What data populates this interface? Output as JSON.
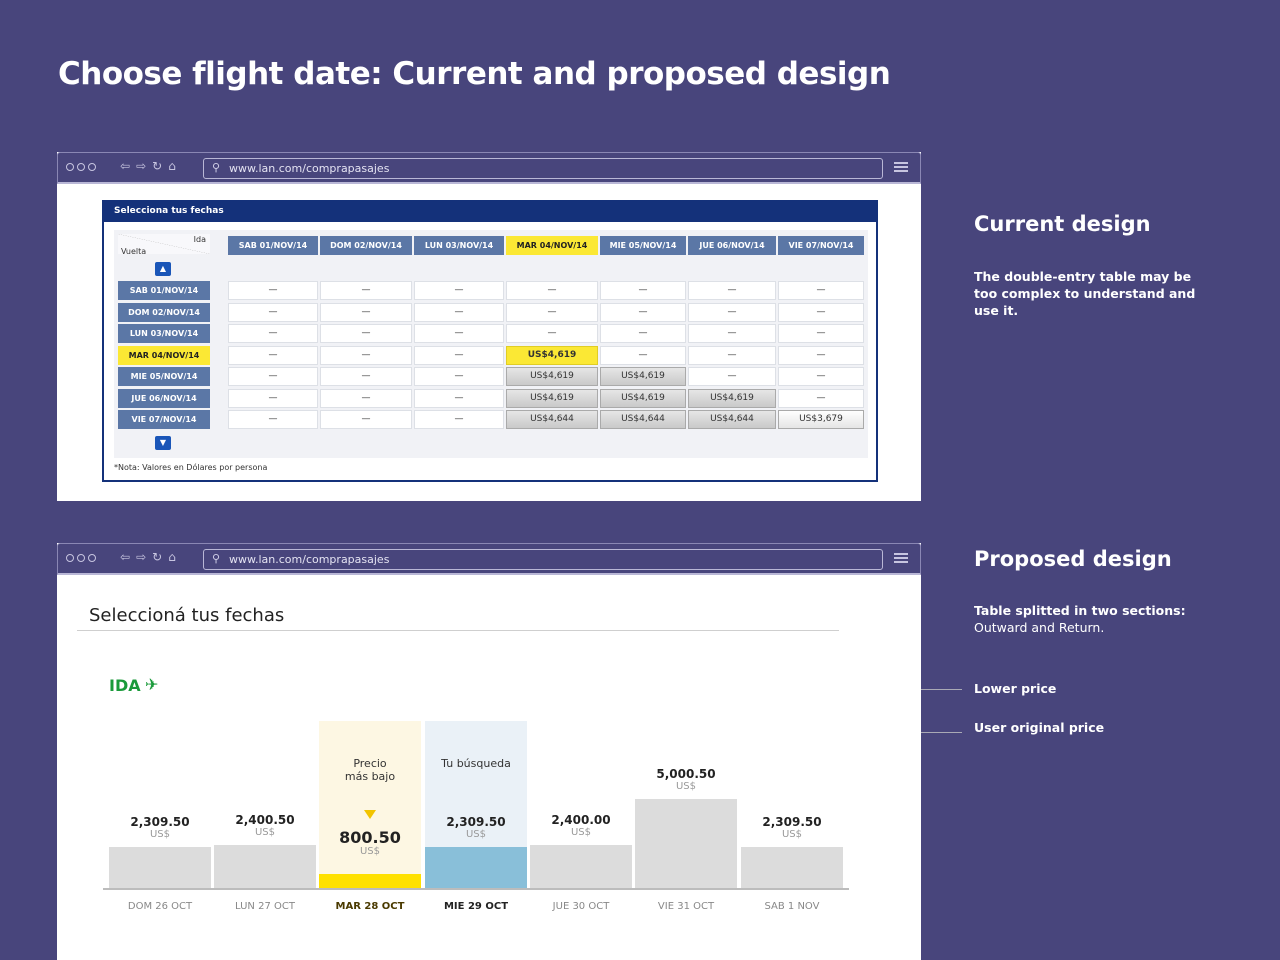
{
  "page": {
    "title": "Choose flight date: Current and proposed design"
  },
  "browser": {
    "url": "www.lan.com/comprapasajes"
  },
  "current": {
    "panel_title": "Selecciona tus fechas",
    "corner_ida": "Ida",
    "corner_vuelta": "Vuelta",
    "columns": [
      "SAB 01/NOV/14",
      "DOM 02/NOV/14",
      "LUN 03/NOV/14",
      "MAR 04/NOV/14",
      "MIE 05/NOV/14",
      "JUE 06/NOV/14",
      "VIE 07/NOV/14"
    ],
    "rows": [
      "SAB 01/NOV/14",
      "DOM 02/NOV/14",
      "LUN 03/NOV/14",
      "MAR 04/NOV/14",
      "MIE 05/NOV/14",
      "JUE 06/NOV/14",
      "VIE 07/NOV/14"
    ],
    "selected_index": 3,
    "cells": [
      [
        "—",
        "—",
        "—",
        "—",
        "—",
        "—",
        "—"
      ],
      [
        "—",
        "—",
        "—",
        "—",
        "—",
        "—",
        "—"
      ],
      [
        "—",
        "—",
        "—",
        "—",
        "—",
        "—",
        "—"
      ],
      [
        "—",
        "—",
        "—",
        "US$4,619",
        "—",
        "—",
        "—"
      ],
      [
        "—",
        "—",
        "—",
        "US$4,619",
        "US$4,619",
        "—",
        "—"
      ],
      [
        "—",
        "—",
        "—",
        "US$4,619",
        "US$4,619",
        "US$4,619",
        "—"
      ],
      [
        "—",
        "—",
        "—",
        "US$4,644",
        "US$4,644",
        "US$4,644",
        "US$3,679"
      ]
    ],
    "note": "*Nota: Valores en Dólares por persona"
  },
  "side": {
    "current_title": "Current design",
    "current_desc": "The double-entry table may be too complex to understand and use it.",
    "proposed_title": "Proposed design",
    "proposed_desc_bold": "Table splitted in two sections:",
    "proposed_desc_normal": "Outward and Return.",
    "lower_price_label": "Lower price",
    "user_price_label": "User original price"
  },
  "proposed": {
    "title": "Seleccioná tus fechas",
    "section_label": "IDA",
    "currency": "US$",
    "lowest_caption": "Precio\nmás bajo",
    "search_caption": "Tu búsqueda",
    "colors": {
      "bar": "#dcdcdc",
      "lowest": "#ffe100",
      "search": "#89bfd9",
      "lowest_bg": "#fdf7e3",
      "search_bg": "#eaf1f7"
    },
    "chart_data": {
      "type": "bar",
      "categories": [
        "DOM 26 OCT",
        "LUN 27 OCT",
        "MAR 28 OCT",
        "MIE 29 OCT",
        "JUE 30 OCT",
        "VIE 31 OCT",
        "SAB 1 NOV"
      ],
      "values": [
        2309.5,
        2400.5,
        800.5,
        2309.5,
        2400.0,
        5000.5,
        2309.5
      ],
      "labels": [
        "2,309.50",
        "2,400.50",
        "800.50",
        "2,309.50",
        "2,400.00",
        "5,000.50",
        "2,309.50"
      ],
      "lowest_index": 2,
      "search_index": 3
    }
  }
}
